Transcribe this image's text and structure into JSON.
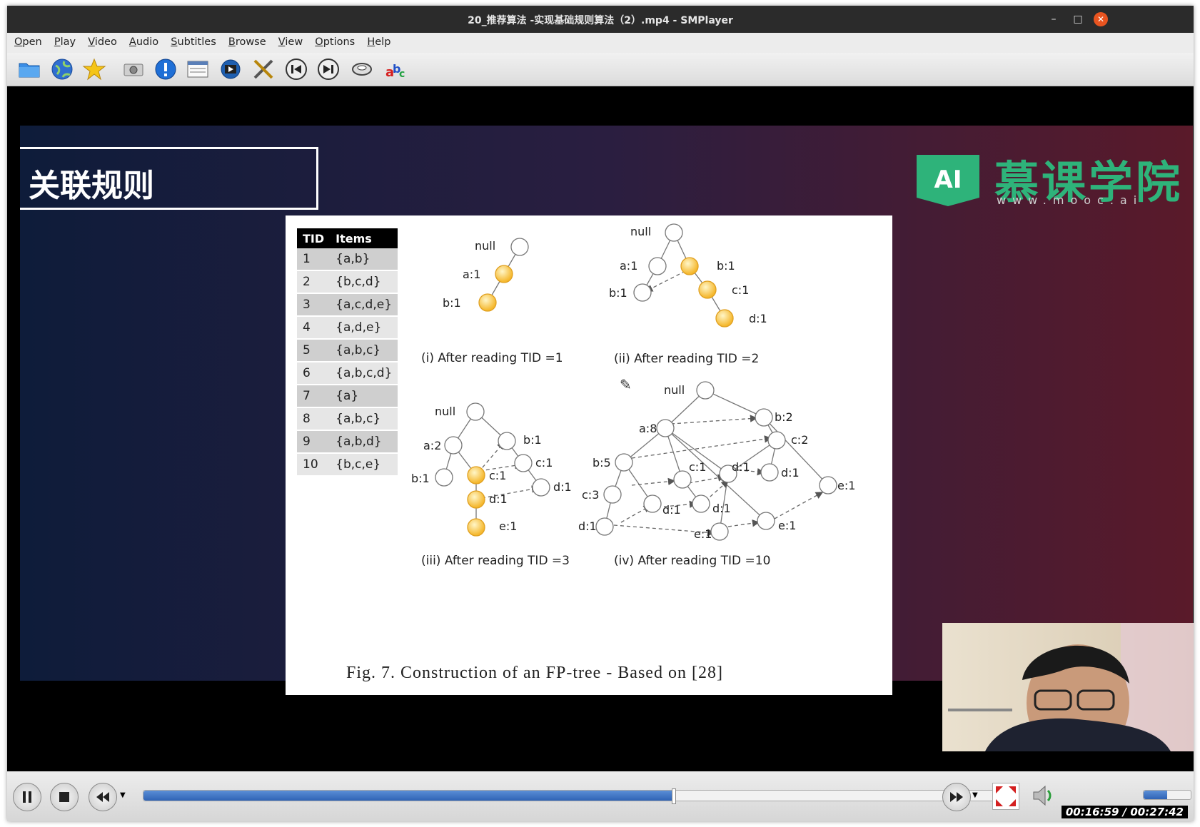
{
  "window": {
    "title": "20_推荐算法 -实现基础规则算法（2）.mp4 - SMPlayer",
    "minimize": "–",
    "maximize": "□",
    "close": "✕"
  },
  "menu": [
    "Open",
    "Play",
    "Video",
    "Audio",
    "Subtitles",
    "Browse",
    "View",
    "Options",
    "Help"
  ],
  "toolbar_icons": [
    "folder-icon",
    "globe-icon",
    "favorites-star-icon",
    "screenshot-camera-icon",
    "info-icon",
    "playlist-icon",
    "video-preferences-icon",
    "tools-icon",
    "previous-icon",
    "next-icon",
    "rotate-icon",
    "subtitles-abc-icon"
  ],
  "slide": {
    "title": "关联规则",
    "logo_mark": "AI",
    "logo_text": "慕课学院",
    "logo_url": "www.mooc.ai",
    "table": {
      "headers": [
        "TID",
        "Items"
      ],
      "rows": [
        [
          "1",
          "{a,b}"
        ],
        [
          "2",
          "{b,c,d}"
        ],
        [
          "3",
          "{a,c,d,e}"
        ],
        [
          "4",
          "{a,d,e}"
        ],
        [
          "5",
          "{a,b,c}"
        ],
        [
          "6",
          "{a,b,c,d}"
        ],
        [
          "7",
          "{a}"
        ],
        [
          "8",
          "{a,b,c}"
        ],
        [
          "9",
          "{a,b,d}"
        ],
        [
          "10",
          "{b,c,e}"
        ]
      ]
    },
    "captions": {
      "c1": "(i) After reading TID =1",
      "c2": "(ii) After reading TID =2",
      "c3": "(iii) After reading TID =3",
      "c4": "(iv) After reading TID =10"
    },
    "figure_caption": "Fig. 7.  Construction of an FP-tree - Based on [28]",
    "tree_labels": {
      "t1": [
        "null",
        "a:1",
        "b:1"
      ],
      "t2": [
        "null",
        "a:1",
        "b:1",
        "b:1",
        "c:1",
        "d:1"
      ],
      "t3": [
        "null",
        "a:2",
        "b:1",
        "b:1",
        "c:1",
        "c:1",
        "d:1",
        "d:1",
        "e:1"
      ],
      "t4": [
        "null",
        "a:8",
        "b:2",
        "c:2",
        "b:5",
        "c:1",
        "d:1",
        "d:1",
        "e:1",
        "c:3",
        "d:1",
        "d:1",
        "d:1",
        "e:1",
        "e:1"
      ]
    }
  },
  "colors": {
    "accent_blue": "#2f63b5",
    "logo_green": "#2eb37a",
    "highlight_node": "#f5c242",
    "close_button": "#e95420"
  },
  "playback": {
    "current": "00:16:59",
    "total": "00:27:42",
    "time_display": "00:16:59 / 00:27:42",
    "progress": 0.613,
    "volume": 0.5
  }
}
